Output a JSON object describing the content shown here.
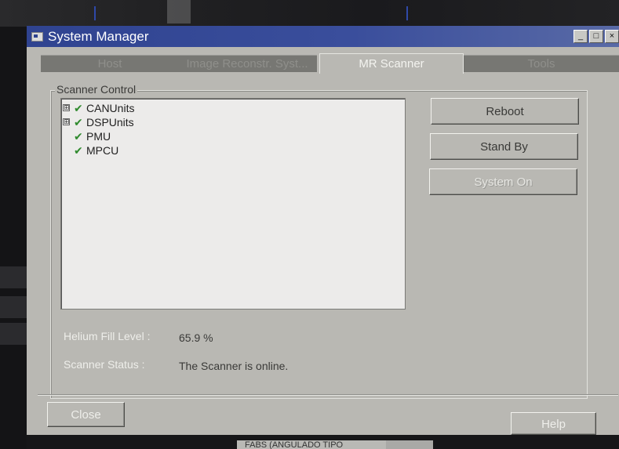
{
  "window": {
    "title": "System Manager",
    "controls": [
      "_",
      "□",
      "×"
    ]
  },
  "tabs": [
    {
      "label": "Host",
      "active": false
    },
    {
      "label": "Image Reconstr. Syst...",
      "active": false
    },
    {
      "label": "MR Scanner",
      "active": true
    },
    {
      "label": "Tools",
      "active": false
    }
  ],
  "scanner_control": {
    "label": "Scanner Control",
    "tree": [
      {
        "label": "CANUnits",
        "expandable": true,
        "status_icon": "check-icon"
      },
      {
        "label": "DSPUnits",
        "expandable": true,
        "status_icon": "check-icon"
      },
      {
        "label": "PMU",
        "expandable": false,
        "status_icon": "check-icon"
      },
      {
        "label": "MPCU",
        "expandable": false,
        "status_icon": "check-icon"
      }
    ],
    "expander_glyph": "⊞",
    "check_glyph": "✔",
    "check_color": "#2f8a2d"
  },
  "actions": {
    "reboot": "Reboot",
    "standby": "Stand By",
    "system_on": "System On"
  },
  "status": {
    "helium_label": "Helium Fill Level :",
    "helium_value": "65.9 %",
    "scanner_label": "Scanner Status :",
    "scanner_value": "The Scanner is online."
  },
  "footer": {
    "close": "Close",
    "help": "Help"
  },
  "background": {
    "bottom_field": "FABS (ANGULADO TIPO"
  }
}
